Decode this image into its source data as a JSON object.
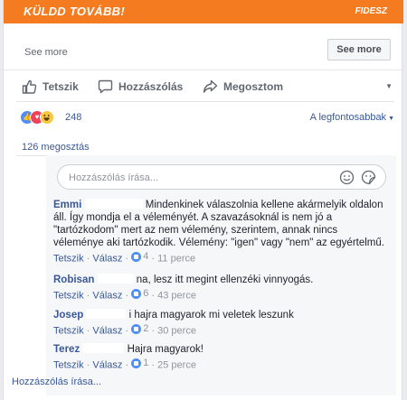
{
  "banner": {
    "left_text": "KÜLDD TOVÁBB!",
    "right_text": "FIDESZ"
  },
  "see_more": {
    "text": "See more",
    "button": "See more"
  },
  "actions": {
    "like": "Tetszik",
    "comment": "Hozzászólás",
    "share": "Megosztom"
  },
  "reactions": {
    "count": "248",
    "sort_label": "A legfontosabbak",
    "types": [
      "like-icon",
      "love-icon",
      "haha-icon"
    ]
  },
  "shares": {
    "label": "126 megosztás"
  },
  "comment_input": {
    "placeholder": "Hozzászólás írása..."
  },
  "comments": [
    {
      "name": "Emmi",
      "text": "Mindenkinek válaszolnia kellene akármelyik oldalon áll. Így mondja el a véleményét. A szavazásoknál is nem jó a \"tartózkodom\" mert az nem vélemény, szerintem, annak nincs véleménye aki tartózkodik. Vélemény: \"igen\" vagy \"nem\" az egyértelmű.",
      "like": "Tetszik",
      "reply": "Válasz",
      "likes": "4",
      "time": "11 perce"
    },
    {
      "name": "Robisan",
      "text": "na, lesz itt megint ellenzéki vinnyogás.",
      "like": "Tetszik",
      "reply": "Válasz",
      "likes": "6",
      "time": "43 perce"
    },
    {
      "name": "Josep",
      "text": "i hajra magyarok mi veletek leszunk",
      "like": "Tetszik",
      "reply": "Válasz",
      "likes": "2",
      "time": "30 perce"
    },
    {
      "name": "Terez",
      "text": "Hajra magyarok!",
      "like": "Tetszik",
      "reply": "Válasz",
      "likes": "1",
      "time": "25 perce"
    }
  ],
  "write_more": "Hozzászólás írása..."
}
